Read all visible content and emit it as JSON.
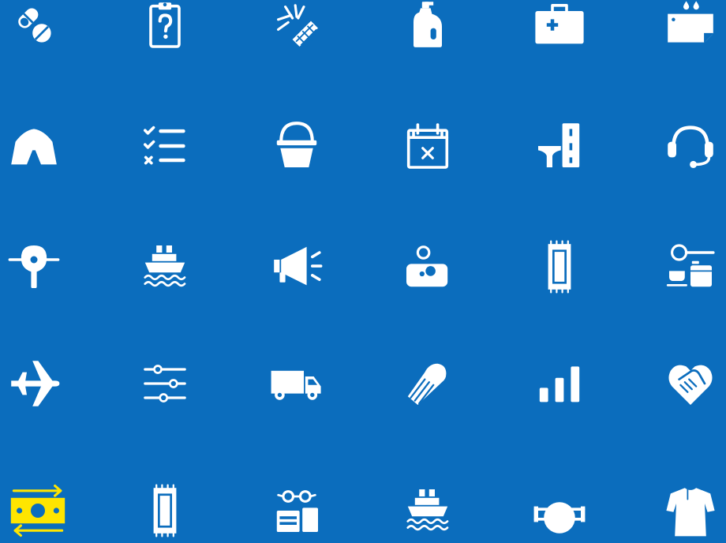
{
  "colors": {
    "background": "#0B6DBD",
    "icon": "#FFFFFF",
    "highlight": "#FFE500"
  },
  "icon_grid": {
    "rows": [
      [
        "pills-icon",
        "clipboard-question-icon",
        "mosquito-net-icon",
        "detergent-bottle-icon",
        "first-aid-kit-icon",
        "leaking-water-icon"
      ],
      [
        "tent-icon",
        "checklist-icon",
        "bucket-icon",
        "calendar-cancel-icon",
        "road-bridge-icon",
        "headset-icon"
      ],
      [
        "oxygen-mask-icon",
        "ship-icon",
        "megaphone-icon",
        "soap-icon",
        "mat-icon",
        "cooking-set-icon"
      ],
      [
        "airplane-icon",
        "sliders-icon",
        "truck-icon",
        "glove-icon",
        "signal-bars-icon",
        "handshake-heart-icon"
      ],
      [
        "cash-transfer-icon",
        "mat-icon",
        "reading-glasses-id-icon",
        "ship-icon",
        "face-mask-icon",
        "robe-icon"
      ]
    ],
    "highlighted": "cash-transfer-icon"
  }
}
